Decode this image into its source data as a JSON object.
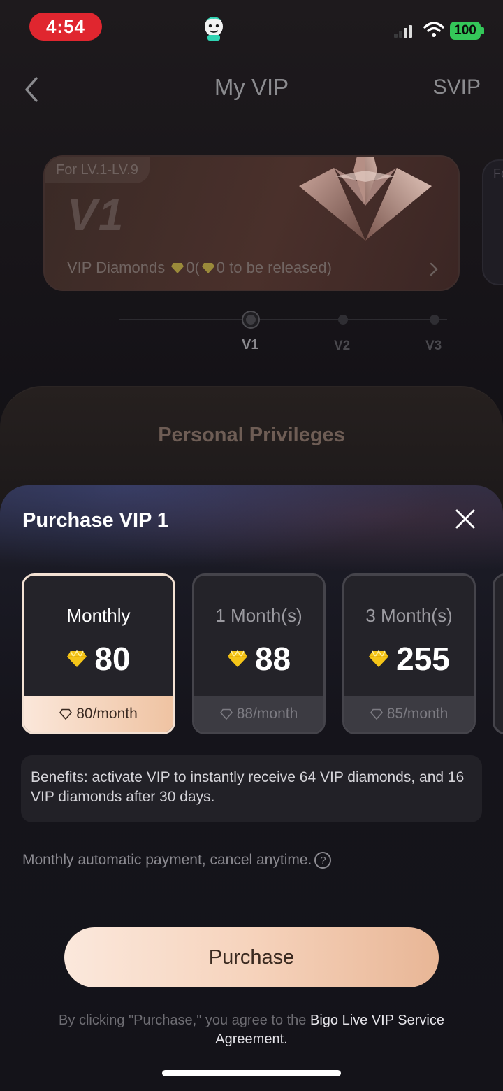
{
  "status_bar": {
    "time": "4:54",
    "battery": "100"
  },
  "header": {
    "title": "My VIP",
    "svip_link": "SVIP"
  },
  "vip_card": {
    "level_range": "For LV.1-LV.9",
    "level": "V1",
    "diamonds_label": "VIP Diamonds",
    "diamonds_value": "0(",
    "released_text": "0 to be released)",
    "next_card_peek": "Fo"
  },
  "level_track": {
    "levels": [
      "V1",
      "V2",
      "V3"
    ],
    "current": "V1"
  },
  "privileges": {
    "title": "Personal Privileges"
  },
  "purchase_sheet": {
    "title": "Purchase VIP 1",
    "plans": [
      {
        "name": "Monthly",
        "price": "80",
        "per_month": "80/month",
        "selected": true
      },
      {
        "name": "1 Month(s)",
        "price": "88",
        "per_month": "88/month",
        "selected": false
      },
      {
        "name": "3 Month(s)",
        "price": "255",
        "per_month": "85/month",
        "selected": false
      }
    ],
    "benefits": "Benefits: activate VIP to instantly receive 64 VIP diamonds, and 16 VIP diamonds after 30 days.",
    "auto_payment_note": "Monthly automatic payment, cancel anytime.",
    "help_symbol": "?",
    "purchase_button": "Purchase",
    "agreement_prefix": "By clicking \"Purchase,\" you agree to the",
    "agreement_link": "Bigo Live VIP Service Agreement."
  },
  "colors": {
    "accent_peach": "#efc3a2",
    "status_red": "#e0262f",
    "battery_green": "#34c759",
    "gem_gold": "#f5c518"
  },
  "icons": [
    "back-icon",
    "close-icon",
    "gem-icon",
    "help-icon",
    "chevron-right-icon",
    "wifi-icon",
    "signal-icon",
    "app-mascot-icon"
  ]
}
